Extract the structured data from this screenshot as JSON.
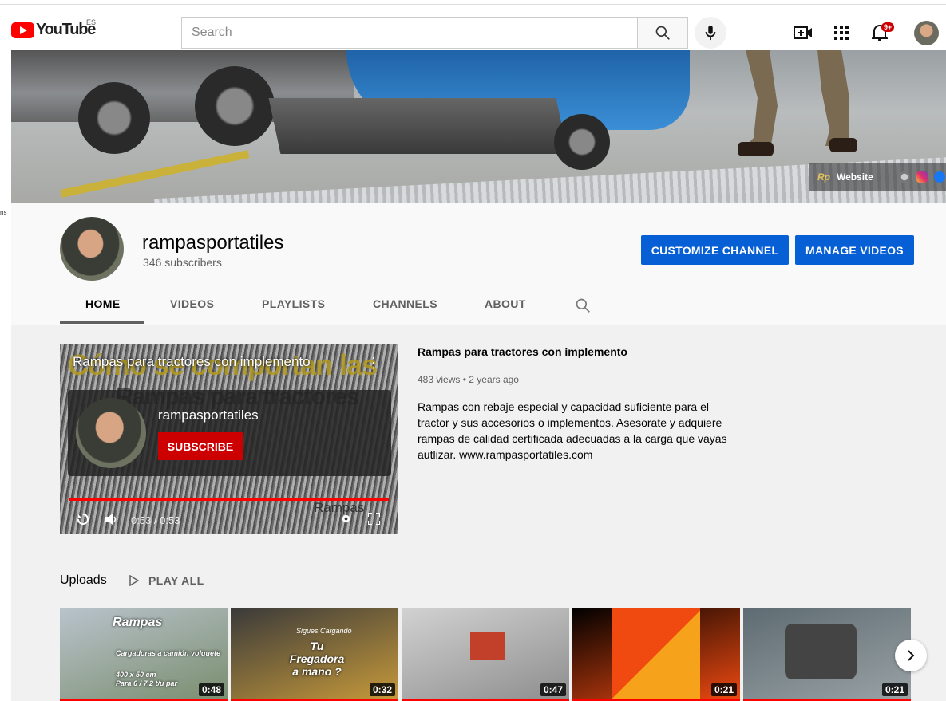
{
  "masthead": {
    "logo_text": "YouTube",
    "country_code": "ES",
    "search_placeholder": "Search",
    "notification_count": "9+"
  },
  "banner": {
    "links": {
      "website_label": "Website"
    }
  },
  "sidebar": {
    "crumb": "ns"
  },
  "channel": {
    "name": "rampasportatiles",
    "subscribers": "346 subscribers",
    "customize_label": "CUSTOMIZE CHANNEL",
    "manage_label": "MANAGE VIDEOS"
  },
  "tabs": [
    {
      "label": "HOME",
      "active": true
    },
    {
      "label": "VIDEOS"
    },
    {
      "label": "PLAYLISTS"
    },
    {
      "label": "CHANNELS"
    },
    {
      "label": "ABOUT"
    }
  ],
  "featured": {
    "title": "Rampas para tractores con implemento",
    "overlay_bg_text": "Cómo se comportan las",
    "overlay_bg_text2": "Rampas para tractores",
    "endcard_name": "rampasportatiles",
    "subscribe_label": "SUBSCRIBE",
    "time": "0:53 / 0:53",
    "watermark": "Rampas",
    "views": "483 views",
    "age": "2 years ago",
    "meta_sep": "•",
    "description": "Rampas con rebaje especial y capacidad suficiente para el tractor y sus accesorios o implementos. Asesorate y adquiere rampas de calidad certificada adecuadas a la carga que vayas autlizar. www.rampasportatiles.com"
  },
  "uploads": {
    "heading": "Uploads",
    "play_all": "PLAY ALL",
    "videos": [
      {
        "duration": "0:48",
        "thumb_text": "Rampas",
        "thumb_sub": "Cargadoras a camión volquete",
        "thumb_dims": "400 x 50 cm",
        "thumb_load": "Para 6 / 7,2 t/u par",
        "colors": [
          "#b9c3cc",
          "#7a8d6e"
        ]
      },
      {
        "duration": "0:32",
        "thumb_text": "Tu Fregadora a mano ?",
        "thumb_sub": "Sigues Cargando",
        "colors": [
          "#3a3a3a",
          "#c79a3a"
        ]
      },
      {
        "duration": "0:47",
        "colors": [
          "#d2d2d2",
          "#8d8d8d"
        ]
      },
      {
        "duration": "0:21",
        "colors": [
          "#000000",
          "#f04a11"
        ]
      },
      {
        "duration": "0:21",
        "colors": [
          "#5e6b72",
          "#9aa3a6"
        ]
      }
    ]
  }
}
